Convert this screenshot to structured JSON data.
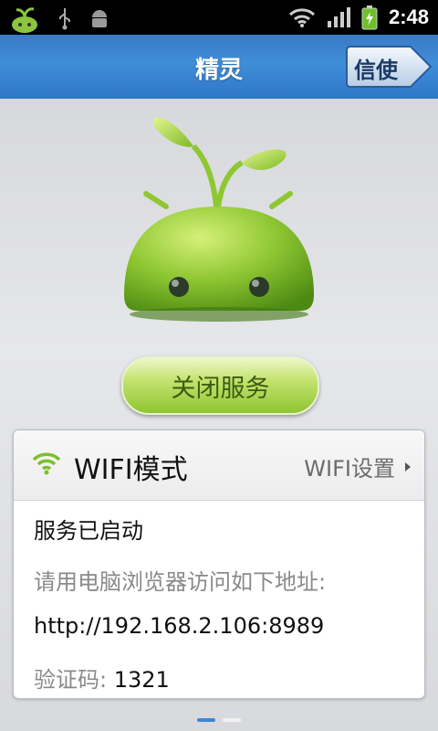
{
  "status_bar": {
    "time": "2:48",
    "icons": [
      "app-sprout-icon",
      "usb-icon",
      "android-debug-icon",
      "wifi-icon",
      "signal-icon",
      "battery-charging-icon"
    ]
  },
  "titlebar": {
    "title": "精灵",
    "nav_button": "信使"
  },
  "main": {
    "mascot_icon": "sprout-android-mascot-icon",
    "close_button": "关闭服务"
  },
  "card": {
    "mode_label": "WIFI模式",
    "settings_link": "WIFI设置",
    "status": "服务已启动",
    "instruction": "请用电脑浏览器访问如下地址:",
    "url": "http://192.168.2.106:8989",
    "code_label": "验证码:",
    "code_value": "1321"
  },
  "colors": {
    "title_blue": "#3f8ed9",
    "accent_green": "#8fc531",
    "wifi_green": "#7bbf2a"
  },
  "pager": {
    "pages": 2,
    "active": 1
  }
}
